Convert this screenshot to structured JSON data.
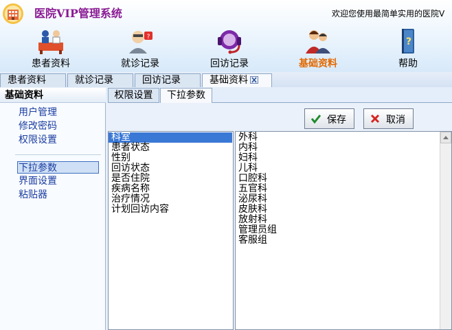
{
  "header": {
    "title": "医院VIP管理系统",
    "welcome": "欢迎您使用最简单实用的医院V",
    "nav": [
      {
        "label": "患者资料",
        "icon": "patient-desk-icon"
      },
      {
        "label": "就诊记录",
        "icon": "doctor-icon"
      },
      {
        "label": "回访记录",
        "icon": "headset-icon"
      },
      {
        "label": "基础资料",
        "icon": "users-icon",
        "active": true
      },
      {
        "label": "帮助",
        "icon": "help-book-icon"
      }
    ]
  },
  "tabs": [
    {
      "label": "患者资料"
    },
    {
      "label": "就诊记录"
    },
    {
      "label": "回访记录"
    },
    {
      "label": "基础资料",
      "active": true
    }
  ],
  "sidebar": {
    "title": "基础资料",
    "group1": [
      "用户管理",
      "修改密码",
      "权限设置"
    ],
    "group2": [
      "下拉参数",
      "界面设置",
      "粘贴器"
    ],
    "selected": "下拉参数"
  },
  "subtabs": [
    {
      "label": "权限设置"
    },
    {
      "label": "下拉参数",
      "active": true
    }
  ],
  "buttons": {
    "save": "保存",
    "cancel": "取消"
  },
  "param_list": {
    "items": [
      "科室",
      "患者状态",
      "性别",
      "回访状态",
      "是否住院",
      "疾病名称",
      "治疗情况",
      "计划回访内容"
    ],
    "selected": "科室"
  },
  "value_list": {
    "items": [
      "外科",
      "内科",
      "妇科",
      "儿科",
      "口腔科",
      "五官科",
      "泌尿科",
      "皮肤科",
      "放射科",
      "管理员组",
      "客服组"
    ]
  },
  "colors": {
    "title": "#8a1a93",
    "active_nav": "#e36a00",
    "selection": "#3a78d6"
  }
}
